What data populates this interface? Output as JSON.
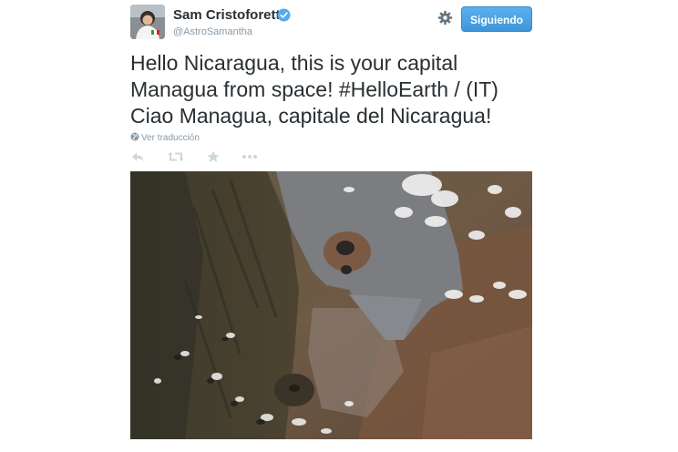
{
  "user": {
    "display_name": "Sam Cristoforetti",
    "handle": "@AstroSamantha",
    "verified": true,
    "avatar_icon": "astronaut-avatar"
  },
  "follow_button": {
    "label": "Siguiendo",
    "color": "#4ba2e6"
  },
  "settings_icon": "gear-icon",
  "tweet": {
    "text_lines": [
      "Hello Nicaragua, this is your capital",
      "Managua from space! ",
      "Ciao Managua, capitale del Nicaragua!"
    ],
    "hashtag": "#HelloEarth",
    "text_line2_suffix": " / (IT)",
    "translate_label": "Ver traducción"
  },
  "actions": [
    "reply-icon",
    "retweet-icon",
    "favorite-icon",
    "more-icon"
  ],
  "photo": {
    "icon": "earth-photo"
  }
}
